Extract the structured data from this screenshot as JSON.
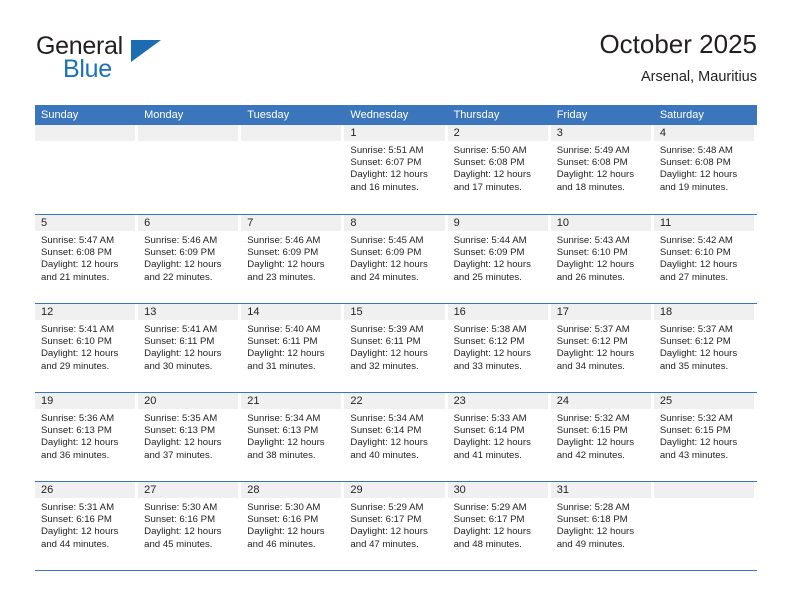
{
  "brand": {
    "name_part1": "General",
    "name_part2": "Blue",
    "flag_icon": "triangle-flag-icon"
  },
  "header": {
    "title": "October 2025",
    "subtitle": "Arsenal, Mauritius"
  },
  "weekdays": [
    "Sunday",
    "Monday",
    "Tuesday",
    "Wednesday",
    "Thursday",
    "Friday",
    "Saturday"
  ],
  "colors": {
    "header_blue": "#3b76bc",
    "brand_blue": "#1b72b8",
    "day_number_bg": "#f0f0f0",
    "text": "#231f20"
  },
  "weeks": [
    [
      {
        "day": "",
        "lines": []
      },
      {
        "day": "",
        "lines": []
      },
      {
        "day": "",
        "lines": []
      },
      {
        "day": "1",
        "lines": [
          "Sunrise: 5:51 AM",
          "Sunset: 6:07 PM",
          "Daylight: 12 hours",
          "and 16 minutes."
        ]
      },
      {
        "day": "2",
        "lines": [
          "Sunrise: 5:50 AM",
          "Sunset: 6:08 PM",
          "Daylight: 12 hours",
          "and 17 minutes."
        ]
      },
      {
        "day": "3",
        "lines": [
          "Sunrise: 5:49 AM",
          "Sunset: 6:08 PM",
          "Daylight: 12 hours",
          "and 18 minutes."
        ]
      },
      {
        "day": "4",
        "lines": [
          "Sunrise: 5:48 AM",
          "Sunset: 6:08 PM",
          "Daylight: 12 hours",
          "and 19 minutes."
        ]
      }
    ],
    [
      {
        "day": "5",
        "lines": [
          "Sunrise: 5:47 AM",
          "Sunset: 6:08 PM",
          "Daylight: 12 hours",
          "and 21 minutes."
        ]
      },
      {
        "day": "6",
        "lines": [
          "Sunrise: 5:46 AM",
          "Sunset: 6:09 PM",
          "Daylight: 12 hours",
          "and 22 minutes."
        ]
      },
      {
        "day": "7",
        "lines": [
          "Sunrise: 5:46 AM",
          "Sunset: 6:09 PM",
          "Daylight: 12 hours",
          "and 23 minutes."
        ]
      },
      {
        "day": "8",
        "lines": [
          "Sunrise: 5:45 AM",
          "Sunset: 6:09 PM",
          "Daylight: 12 hours",
          "and 24 minutes."
        ]
      },
      {
        "day": "9",
        "lines": [
          "Sunrise: 5:44 AM",
          "Sunset: 6:09 PM",
          "Daylight: 12 hours",
          "and 25 minutes."
        ]
      },
      {
        "day": "10",
        "lines": [
          "Sunrise: 5:43 AM",
          "Sunset: 6:10 PM",
          "Daylight: 12 hours",
          "and 26 minutes."
        ]
      },
      {
        "day": "11",
        "lines": [
          "Sunrise: 5:42 AM",
          "Sunset: 6:10 PM",
          "Daylight: 12 hours",
          "and 27 minutes."
        ]
      }
    ],
    [
      {
        "day": "12",
        "lines": [
          "Sunrise: 5:41 AM",
          "Sunset: 6:10 PM",
          "Daylight: 12 hours",
          "and 29 minutes."
        ]
      },
      {
        "day": "13",
        "lines": [
          "Sunrise: 5:41 AM",
          "Sunset: 6:11 PM",
          "Daylight: 12 hours",
          "and 30 minutes."
        ]
      },
      {
        "day": "14",
        "lines": [
          "Sunrise: 5:40 AM",
          "Sunset: 6:11 PM",
          "Daylight: 12 hours",
          "and 31 minutes."
        ]
      },
      {
        "day": "15",
        "lines": [
          "Sunrise: 5:39 AM",
          "Sunset: 6:11 PM",
          "Daylight: 12 hours",
          "and 32 minutes."
        ]
      },
      {
        "day": "16",
        "lines": [
          "Sunrise: 5:38 AM",
          "Sunset: 6:12 PM",
          "Daylight: 12 hours",
          "and 33 minutes."
        ]
      },
      {
        "day": "17",
        "lines": [
          "Sunrise: 5:37 AM",
          "Sunset: 6:12 PM",
          "Daylight: 12 hours",
          "and 34 minutes."
        ]
      },
      {
        "day": "18",
        "lines": [
          "Sunrise: 5:37 AM",
          "Sunset: 6:12 PM",
          "Daylight: 12 hours",
          "and 35 minutes."
        ]
      }
    ],
    [
      {
        "day": "19",
        "lines": [
          "Sunrise: 5:36 AM",
          "Sunset: 6:13 PM",
          "Daylight: 12 hours",
          "and 36 minutes."
        ]
      },
      {
        "day": "20",
        "lines": [
          "Sunrise: 5:35 AM",
          "Sunset: 6:13 PM",
          "Daylight: 12 hours",
          "and 37 minutes."
        ]
      },
      {
        "day": "21",
        "lines": [
          "Sunrise: 5:34 AM",
          "Sunset: 6:13 PM",
          "Daylight: 12 hours",
          "and 38 minutes."
        ]
      },
      {
        "day": "22",
        "lines": [
          "Sunrise: 5:34 AM",
          "Sunset: 6:14 PM",
          "Daylight: 12 hours",
          "and 40 minutes."
        ]
      },
      {
        "day": "23",
        "lines": [
          "Sunrise: 5:33 AM",
          "Sunset: 6:14 PM",
          "Daylight: 12 hours",
          "and 41 minutes."
        ]
      },
      {
        "day": "24",
        "lines": [
          "Sunrise: 5:32 AM",
          "Sunset: 6:15 PM",
          "Daylight: 12 hours",
          "and 42 minutes."
        ]
      },
      {
        "day": "25",
        "lines": [
          "Sunrise: 5:32 AM",
          "Sunset: 6:15 PM",
          "Daylight: 12 hours",
          "and 43 minutes."
        ]
      }
    ],
    [
      {
        "day": "26",
        "lines": [
          "Sunrise: 5:31 AM",
          "Sunset: 6:16 PM",
          "Daylight: 12 hours",
          "and 44 minutes."
        ]
      },
      {
        "day": "27",
        "lines": [
          "Sunrise: 5:30 AM",
          "Sunset: 6:16 PM",
          "Daylight: 12 hours",
          "and 45 minutes."
        ]
      },
      {
        "day": "28",
        "lines": [
          "Sunrise: 5:30 AM",
          "Sunset: 6:16 PM",
          "Daylight: 12 hours",
          "and 46 minutes."
        ]
      },
      {
        "day": "29",
        "lines": [
          "Sunrise: 5:29 AM",
          "Sunset: 6:17 PM",
          "Daylight: 12 hours",
          "and 47 minutes."
        ]
      },
      {
        "day": "30",
        "lines": [
          "Sunrise: 5:29 AM",
          "Sunset: 6:17 PM",
          "Daylight: 12 hours",
          "and 48 minutes."
        ]
      },
      {
        "day": "31",
        "lines": [
          "Sunrise: 5:28 AM",
          "Sunset: 6:18 PM",
          "Daylight: 12 hours",
          "and 49 minutes."
        ]
      },
      {
        "day": "",
        "lines": []
      }
    ]
  ]
}
